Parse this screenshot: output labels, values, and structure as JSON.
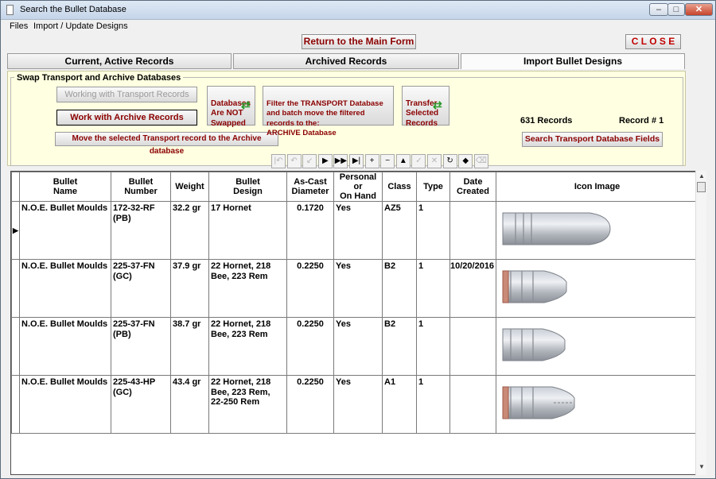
{
  "window": {
    "title": "Search the Bullet Database",
    "minimize": "–",
    "maximize": "□",
    "close": "✕"
  },
  "menu": [
    "Files",
    "Import / Update Designs"
  ],
  "top_buttons": {
    "main_form": "Return to the Main Form",
    "close": "C L O S E"
  },
  "tabs": [
    {
      "label": "Current, Active Records",
      "active": false
    },
    {
      "label": "Archived Records",
      "active": false
    },
    {
      "label": "Import Bullet Designs",
      "active": true
    }
  ],
  "swap_panel": {
    "title": "Swap Transport and Archive Databases",
    "working_transport": "Working with Transport Records",
    "work_archive": "Work with Archive Records",
    "move_record": "Move the selected Transport record to the Archive database",
    "databases_not_swapped": "Databases\nAre NOT\nSwapped",
    "filter_transport": "Filter the TRANSPORT Database\nand batch move the filtered records to the:\nARCHIVE Database",
    "transfer_selected": "Transfer\nSelected\nRecords",
    "record_count": "631 Records",
    "record_number": "Record # 1",
    "search_fields": "Search Transport Database Fields"
  },
  "nav_buttons": [
    {
      "name": "first-record-icon",
      "glyph": "|↶",
      "enabled": false
    },
    {
      "name": "previous-page-icon",
      "glyph": "↶",
      "enabled": false
    },
    {
      "name": "previous-record-icon",
      "glyph": "↙",
      "enabled": false
    },
    {
      "name": "next-record-icon",
      "glyph": "▶",
      "enabled": true
    },
    {
      "name": "next-page-icon",
      "glyph": "▶▶",
      "enabled": true
    },
    {
      "name": "last-record-icon",
      "glyph": "▶|",
      "enabled": true
    },
    {
      "name": "add-record-icon",
      "glyph": "+",
      "enabled": true
    },
    {
      "name": "delete-record-icon",
      "glyph": "−",
      "enabled": true
    },
    {
      "name": "move-up-icon",
      "glyph": "▲",
      "enabled": true
    },
    {
      "name": "post-edit-icon",
      "glyph": "✓",
      "enabled": false
    },
    {
      "name": "cancel-edit-icon",
      "glyph": "✕",
      "enabled": false
    },
    {
      "name": "refresh-icon",
      "glyph": "↻",
      "enabled": true
    },
    {
      "name": "bookmark-icon",
      "glyph": "◆",
      "enabled": true
    },
    {
      "name": "undo-icon",
      "glyph": "⌫",
      "enabled": false
    }
  ],
  "grid": {
    "columns": [
      "Bullet\nName",
      "Bullet\nNumber",
      "Weight",
      "Bullet\nDesign",
      "As-Cast\nDiameter",
      "Personal or\nOn Hand",
      "Class",
      "Type",
      "Date\nCreated",
      "Icon Image"
    ],
    "rows": [
      {
        "name": "N.O.E. Bullet Moulds",
        "number": "172-32-RF (PB)",
        "weight": "32.2 gr",
        "design": "17 Hornet",
        "diameter": "0.1720",
        "personal": "Yes",
        "class": "AZ5",
        "type": "1",
        "date": "",
        "icon": {
          "kind": "round-flat",
          "length": 133,
          "gas_check": false
        }
      },
      {
        "name": "N.O.E. Bullet Moulds",
        "number": "225-37-FN (GC)",
        "weight": "37.9 gr",
        "design": "22 Hornet, 218 Bee, 223 Rem",
        "diameter": "0.2250",
        "personal": "Yes",
        "class": "B2",
        "type": "1",
        "date": "10/20/2016",
        "icon": {
          "kind": "flat-nose",
          "length": 82,
          "gas_check": true
        }
      },
      {
        "name": "N.O.E. Bullet Moulds",
        "number": "225-37-FN (PB)",
        "weight": "38.7 gr",
        "design": "22 Hornet, 218 Bee, 223 Rem",
        "diameter": "0.2250",
        "personal": "Yes",
        "class": "B2",
        "type": "1",
        "date": "",
        "icon": {
          "kind": "flat-nose",
          "length": 80,
          "gas_check": false
        }
      },
      {
        "name": "N.O.E. Bullet Moulds",
        "number": "225-43-HP (GC)",
        "weight": "43.4 gr",
        "design": "22 Hornet, 218 Bee, 223 Rem, 22-250 Rem",
        "diameter": "0.2250",
        "personal": "Yes",
        "class": "A1",
        "type": "1",
        "date": "",
        "icon": {
          "kind": "hollow-point",
          "length": 92,
          "gas_check": true
        }
      }
    ]
  }
}
